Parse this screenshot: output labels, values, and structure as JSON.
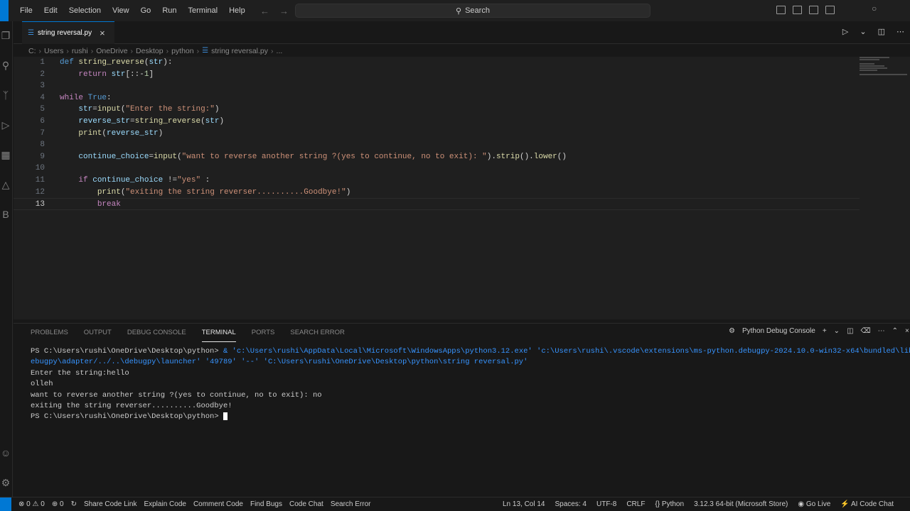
{
  "menu": [
    "File",
    "Edit",
    "Selection",
    "View",
    "Go",
    "Run",
    "Terminal",
    "Help"
  ],
  "search": {
    "label": "Search"
  },
  "tab": {
    "title": "string reversal.py"
  },
  "breadcrumb": [
    "C:",
    "Users",
    "rushi",
    "OneDrive",
    "Desktop",
    "python",
    "string reversal.py",
    "..."
  ],
  "code_lines": [
    {
      "n": "1",
      "text": "def string_reverse(str):"
    },
    {
      "n": "2",
      "text": "    return str[::-1]"
    },
    {
      "n": "3",
      "text": ""
    },
    {
      "n": "4",
      "text": "while True:"
    },
    {
      "n": "5",
      "text": "    str=input(\"Enter the string:\")"
    },
    {
      "n": "6",
      "text": "    reverse_str=string_reverse(str)"
    },
    {
      "n": "7",
      "text": "    print(reverse_str)"
    },
    {
      "n": "8",
      "text": ""
    },
    {
      "n": "9",
      "text": "    continue_choice=input(\"want to reverse another string ?(yes to continue, no to exit): \").strip().lower()"
    },
    {
      "n": "10",
      "text": ""
    },
    {
      "n": "11",
      "text": "    if continue_choice !=\"yes\" :"
    },
    {
      "n": "12",
      "text": "        print(\"exiting the string reverser..........Goodbye!\")"
    },
    {
      "n": "13",
      "text": "        break"
    }
  ],
  "panel": {
    "tabs": [
      "PROBLEMS",
      "OUTPUT",
      "DEBUG CONSOLE",
      "TERMINAL",
      "PORTS",
      "SEARCH ERROR"
    ],
    "active_tab": "TERMINAL",
    "console_label": "Python Debug Console"
  },
  "terminal": {
    "prompt": "PS C:\\Users\\rushi\\OneDrive\\Desktop\\python>",
    "command_line1": " & 'c:\\Users\\rushi\\AppData\\Local\\Microsoft\\WindowsApps\\python3.12.exe' 'c:\\Users\\rushi\\.vscode\\extensions\\ms-python.debugpy-2024.10.0-win32-x64\\bundled\\libs\\d",
    "command_line2": "ebugpy\\adapter/../..\\debugpy\\launcher' '49789' '--' 'C:\\Users\\rushi\\OneDrive\\Desktop\\python\\string reversal.py'",
    "output": [
      "Enter the string:hello",
      "olleh",
      "want to reverse another string ?(yes to continue, no to exit): no",
      "exiting the string reverser..........Goodbye!"
    ]
  },
  "status": {
    "errors": "0",
    "warnings": "0",
    "ports": "0",
    "left_items": [
      "Share Code Link",
      "Explain Code",
      "Comment Code",
      "Find Bugs",
      "Code Chat",
      "Search Error"
    ],
    "position": "Ln 13, Col 14",
    "spaces": "Spaces: 4",
    "encoding": "UTF-8",
    "eol": "CRLF",
    "language": "Python",
    "interpreter": "3.12.3 64-bit (Microsoft Store)",
    "golive": "Go Live",
    "aichat": "AI Code Chat"
  },
  "colors": {
    "accent": "#0078d4",
    "editor_bg": "#1f1f1f",
    "keyword": "#569cd6",
    "string": "#ce9178",
    "function": "#dcdcaa"
  }
}
